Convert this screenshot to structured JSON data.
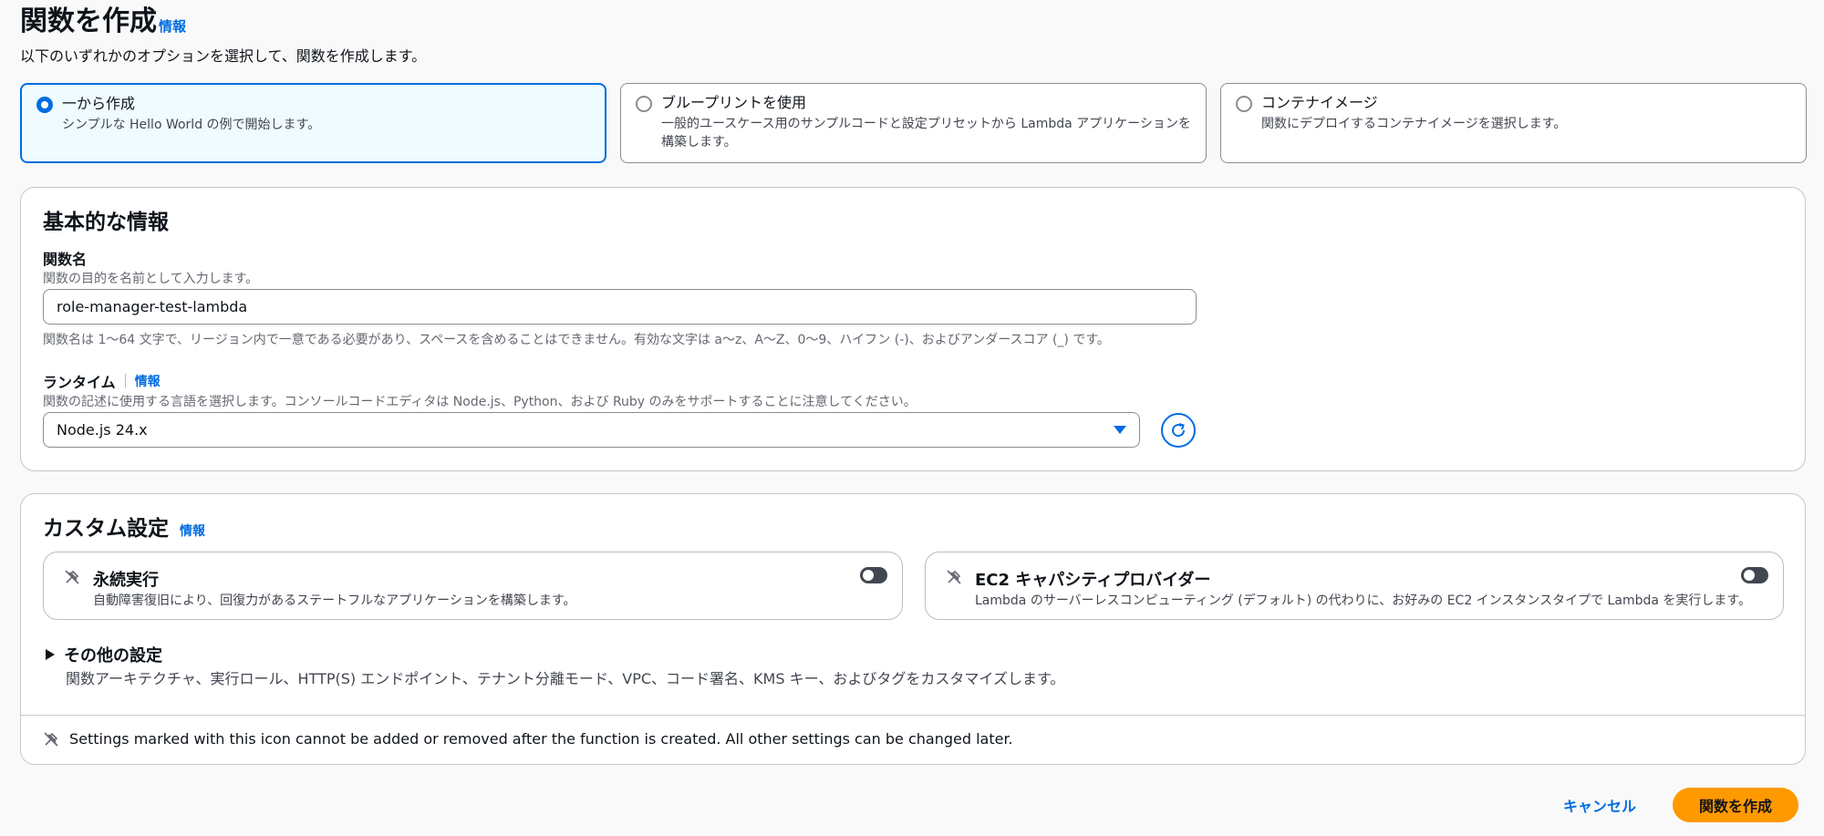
{
  "header": {
    "title": "関数を作成",
    "info": "情報",
    "description": "以下のいずれかのオプションを選択して、関数を作成します。"
  },
  "options": [
    {
      "title": "一から作成",
      "desc": "シンプルな Hello World の例で開始します。",
      "selected": true
    },
    {
      "title": "ブループリントを使用",
      "desc": "一般的ユースケース用のサンプルコードと設定プリセットから Lambda アプリケーションを構築します。",
      "selected": false
    },
    {
      "title": "コンテナイメージ",
      "desc": "関数にデプロイするコンテナイメージを選択します。",
      "selected": false
    }
  ],
  "basic": {
    "heading": "基本的な情報",
    "function_name": {
      "label": "関数名",
      "hint": "関数の目的を名前として入力します。",
      "value": "role-manager-test-lambda",
      "constraint": "関数名は 1〜64 文字で、リージョン内で一意である必要があり、スペースを含めることはできません。有効な文字は a〜z、A〜Z、0〜9、ハイフン (-)、およびアンダースコア (_) です。"
    },
    "runtime": {
      "label": "ランタイム",
      "info": "情報",
      "hint": "関数の記述に使用する言語を選択します。コンソールコードエディタは Node.js、Python、および Ruby のみをサポートすることに注意してください。",
      "value": "Node.js 24.x"
    }
  },
  "custom": {
    "heading": "カスタム設定",
    "info": "情報",
    "durable": {
      "title": "永続実行",
      "desc": "自動障害復旧により、回復力があるステートフルなアプリケーションを構築します。",
      "enabled": false
    },
    "ec2": {
      "title": "EC2 キャパシティプロバイダー",
      "desc": "Lambda のサーバーレスコンピューティング (デフォルト) の代わりに、お好みの EC2 インスタンスタイプで Lambda を実行します。",
      "enabled": false
    },
    "other": {
      "title": "その他の設定",
      "desc": "関数アーキテクチャ、実行ロール、HTTP(S) エンドポイント、テナント分離モード、VPC、コード署名、KMS キー、およびタグをカスタマイズします。"
    },
    "footnote": "Settings marked with this icon cannot be added or removed after the function is created. All other settings can be changed later."
  },
  "actions": {
    "cancel": "キャンセル",
    "create": "関数を作成"
  },
  "colors": {
    "accent": "#006ce0",
    "primary_button": "#ff9900"
  }
}
